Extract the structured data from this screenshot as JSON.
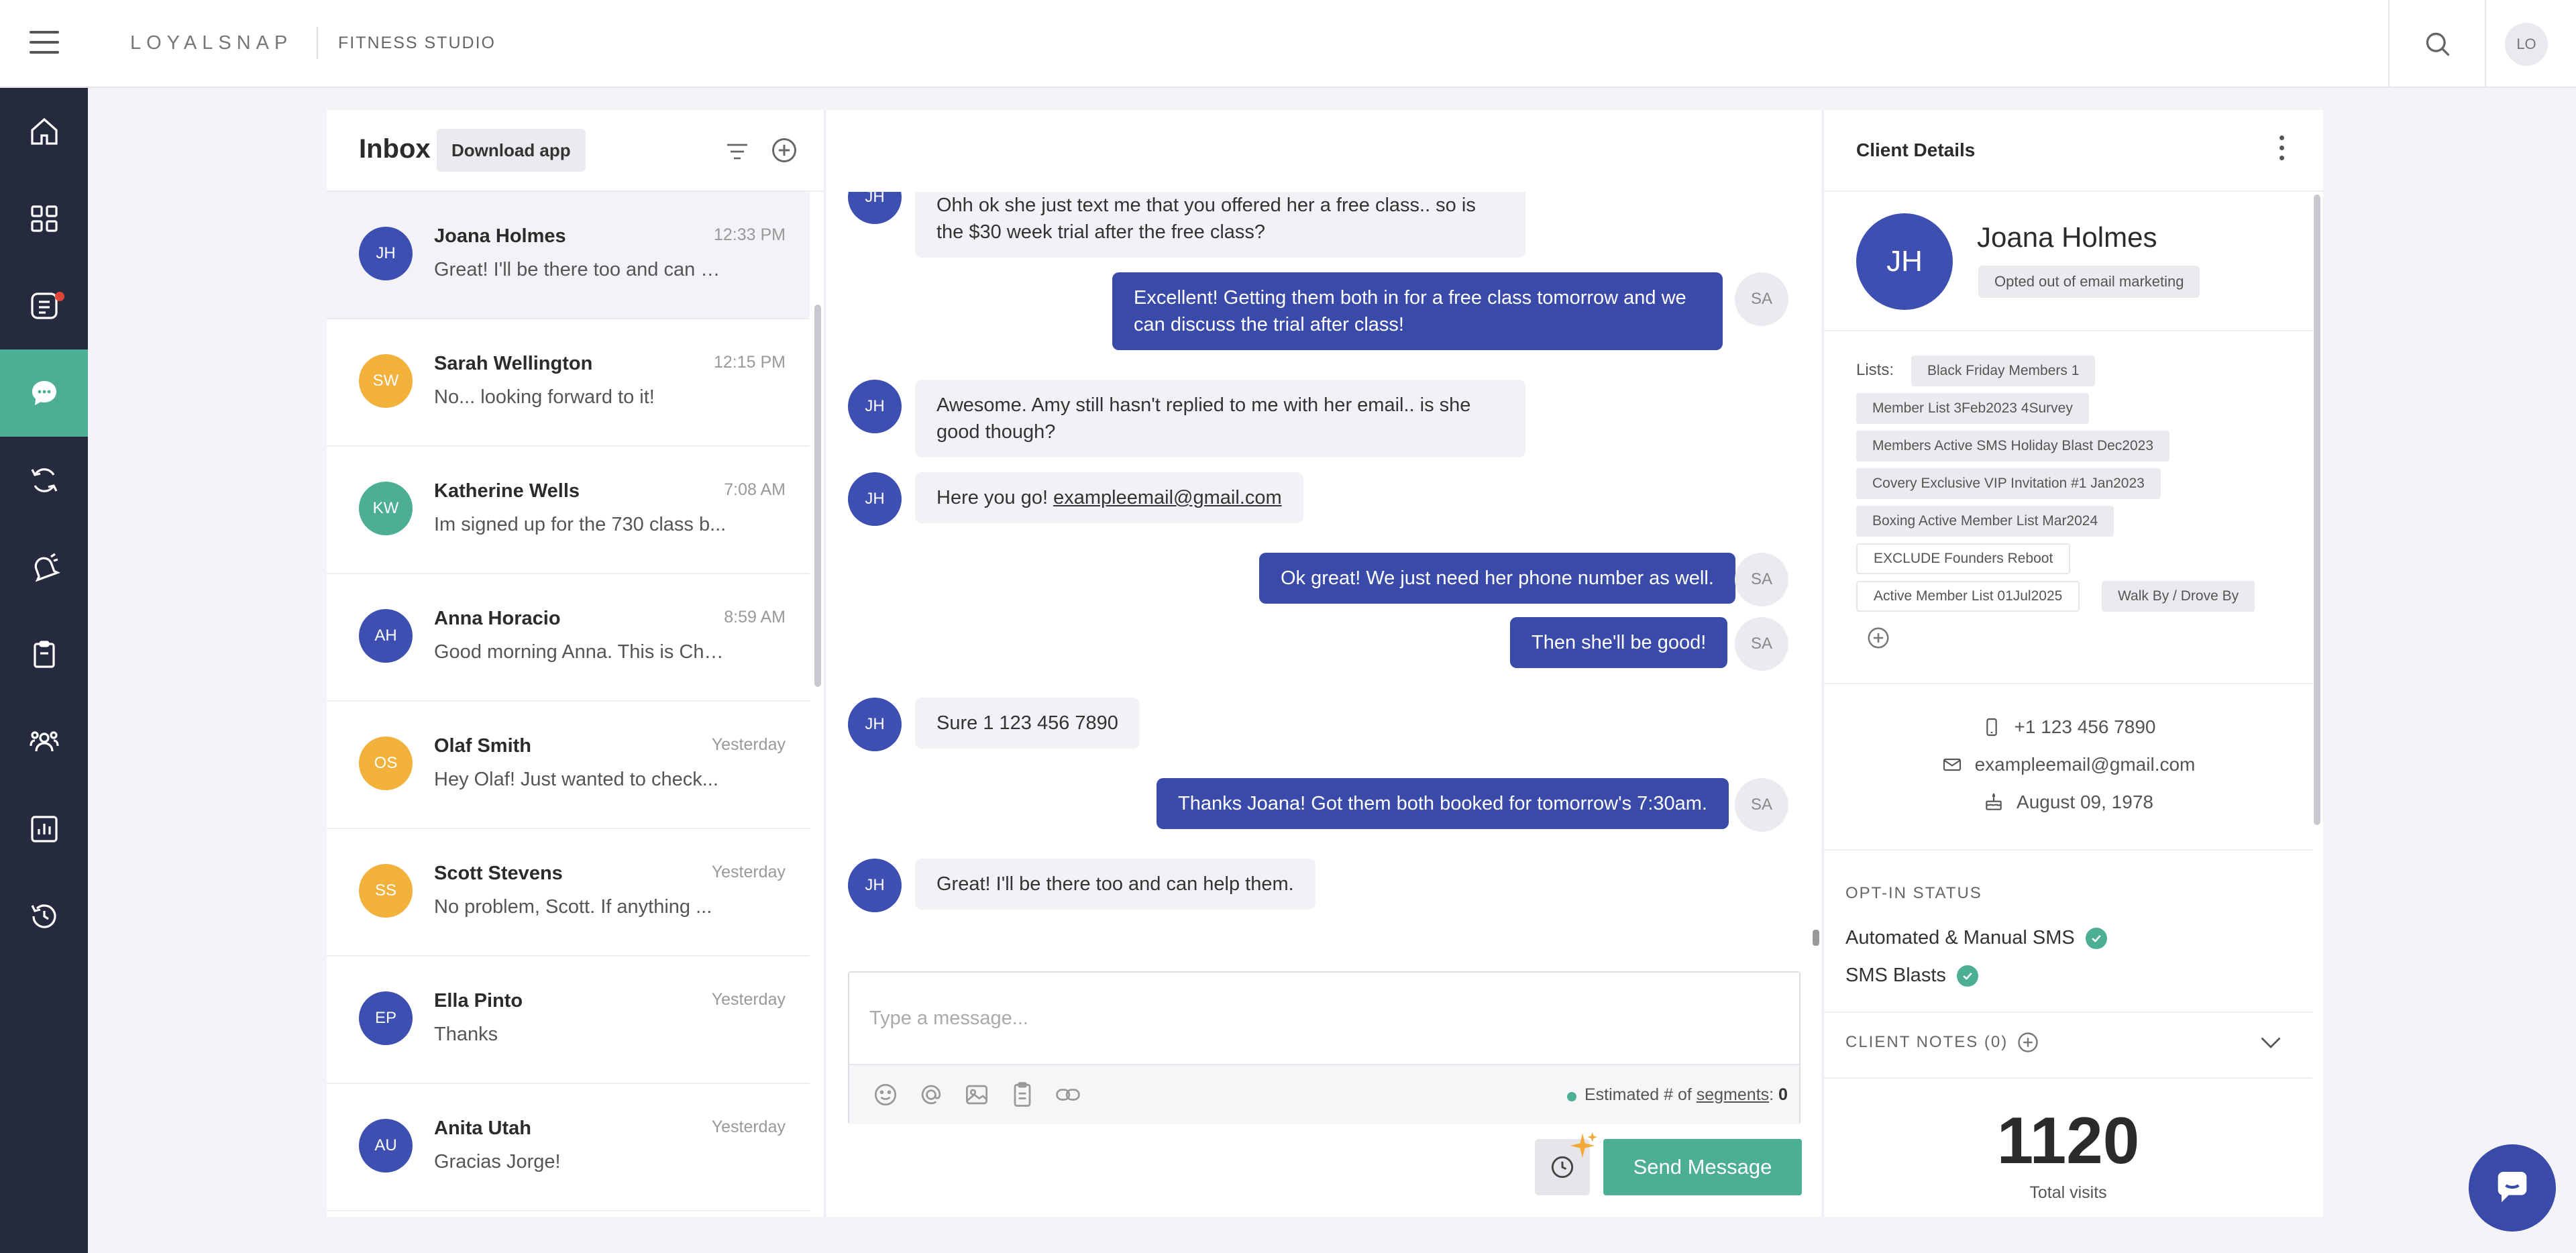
{
  "header": {
    "brand": "LOYALSNAP",
    "studio": "FITNESS STUDIO",
    "user_initials": "LO"
  },
  "nav": {
    "items": [
      "home-icon",
      "grid-icon",
      "checklist-icon",
      "chat-icon",
      "refresh-icon",
      "bell-icon",
      "clipboard-icon",
      "community-icon",
      "chart-icon",
      "history-icon"
    ],
    "active": "chat-icon",
    "accent_color": "#4caf93"
  },
  "inbox": {
    "title": "Inbox",
    "download_label": "Download app",
    "conversations": [
      {
        "initials": "JH",
        "name": "Joana Holmes",
        "time": "12:33 PM",
        "preview": "Great! I'll be there too and can help them.",
        "color": "#3d4fb0"
      },
      {
        "initials": "SW",
        "name": "Sarah Wellington",
        "time": "12:15 PM",
        "preview": "No... looking forward to it!",
        "color": "#f2b13a"
      },
      {
        "initials": "KW",
        "name": "Katherine Wells",
        "time": "7:08 AM",
        "preview": "Im signed up for the 730 class b...",
        "color": "#4caf93"
      },
      {
        "initials": "AH",
        "name": "Anna Horacio",
        "time": "8:59 AM",
        "preview": "Good morning Anna. This is Chri...",
        "color": "#3d4fb0"
      },
      {
        "initials": "OS",
        "name": "Olaf Smith",
        "time": "Yesterday",
        "preview": "Hey Olaf! Just wanted to check...",
        "color": "#f2b13a"
      },
      {
        "initials": "SS",
        "name": "Scott Stevens",
        "time": "Yesterday",
        "preview": "No problem, Scott. If anything ...",
        "color": "#f2b13a"
      },
      {
        "initials": "EP",
        "name": "Ella Pinto",
        "time": "Yesterday",
        "preview": "Thanks",
        "color": "#3d4fb0"
      },
      {
        "initials": "AU",
        "name": "Anita Utah",
        "time": "Yesterday",
        "preview": "Gracias Jorge!",
        "color": "#3d4fb0"
      }
    ]
  },
  "chat": {
    "messages": [
      {
        "dir": "in",
        "initials": "JH",
        "text": "Ohh ok she just text me that you offered her a free class.. so is the $30 week trial after the free class?"
      },
      {
        "dir": "out",
        "initials": "SA",
        "text": "Excellent! Getting them both in for a free class tomorrow and we can discuss the trial after class!"
      },
      {
        "dir": "in",
        "initials": "JH",
        "text": "Awesome. Amy still hasn't replied to me with her email.. is she good though?"
      },
      {
        "dir": "in",
        "initials": "JH",
        "text_prefix": "Here you go! ",
        "link": "exampleemail@gmail.com"
      },
      {
        "dir": "out",
        "initials": "SA",
        "text": "Ok great! We just need her phone number as well."
      },
      {
        "dir": "out",
        "initials": "SA",
        "text": "Then she'll be good!"
      },
      {
        "dir": "in",
        "initials": "JH",
        "text": "Sure 1 123 456 7890"
      },
      {
        "dir": "out",
        "initials": "SA",
        "text": "Thanks Joana! Got them both booked for tomorrow's 7:30am."
      },
      {
        "dir": "in",
        "initials": "JH",
        "text": "Great! I'll be there too and can help them."
      }
    ],
    "composer_placeholder": "Type a message...",
    "segments_prefix": "Estimated # of ",
    "segments_link": "segments",
    "segments_sep": ": ",
    "segments_value": "0",
    "send_label": "Send Message",
    "tool_icons": [
      "emoji-icon",
      "mention-icon",
      "image-icon",
      "template-icon",
      "link-icon"
    ]
  },
  "client": {
    "title": "Client Details",
    "initials": "JH",
    "name": "Joana Holmes",
    "badge": "Opted out of email marketing",
    "lists_label": "Lists:",
    "lists": [
      "Black Friday Members 1",
      "Member List 3Feb2023 4Survey",
      "Members Active SMS Holiday Blast Dec2023",
      "Covery Exclusive VIP Invitation #1 Jan2023",
      "Boxing Active Member List Mar2024",
      "EXCLUDE Founders Reboot",
      "Active Member List 01Jul2025",
      "Walk By / Drove By"
    ],
    "phone": "+1 123 456 7890",
    "email": "exampleemail@gmail.com",
    "birthday": "August 09, 1978",
    "optin_title": "OPT-IN STATUS",
    "optin": [
      "Automated & Manual SMS",
      "SMS Blasts"
    ],
    "notes_title": "CLIENT NOTES (0)",
    "visits": "1120",
    "visits_label": "Total visits"
  }
}
